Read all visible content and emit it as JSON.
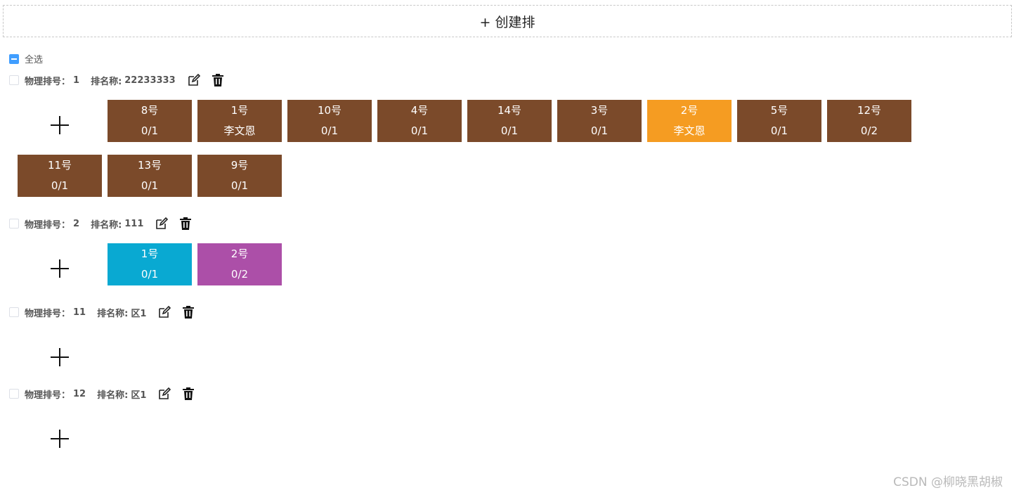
{
  "create_button": {
    "label": "+ 创建排"
  },
  "select_all": {
    "label": "全选"
  },
  "rows": [
    {
      "physical_label": "物理排号：",
      "physical_no": "1",
      "name_label": "排名称:",
      "name": "22233333",
      "seats": [
        {
          "num": "8号",
          "occ": "0/1",
          "color": "#7b4a2a"
        },
        {
          "num": "1号",
          "occ": "李文恩",
          "color": "#7b4a2a"
        },
        {
          "num": "10号",
          "occ": "0/1",
          "color": "#7b4a2a"
        },
        {
          "num": "4号",
          "occ": "0/1",
          "color": "#7b4a2a"
        },
        {
          "num": "14号",
          "occ": "0/1",
          "color": "#7b4a2a"
        },
        {
          "num": "3号",
          "occ": "0/1",
          "color": "#7b4a2a"
        },
        {
          "num": "2号",
          "occ": "李文恩",
          "color": "#f59c22"
        },
        {
          "num": "5号",
          "occ": "0/1",
          "color": "#7b4a2a"
        },
        {
          "num": "12号",
          "occ": "0/2",
          "color": "#7b4a2a"
        },
        {
          "num": "11号",
          "occ": "0/1",
          "color": "#7b4a2a"
        },
        {
          "num": "13号",
          "occ": "0/1",
          "color": "#7b4a2a"
        },
        {
          "num": "9号",
          "occ": "0/1",
          "color": "#7b4a2a"
        }
      ]
    },
    {
      "physical_label": "物理排号：",
      "physical_no": "2",
      "name_label": "排名称:",
      "name": "111",
      "seats": [
        {
          "num": "1号",
          "occ": "0/1",
          "color": "#09a9d2"
        },
        {
          "num": "2号",
          "occ": "0/2",
          "color": "#ac4fa8"
        }
      ]
    },
    {
      "physical_label": "物理排号：",
      "physical_no": "11",
      "name_label": "排名称:",
      "name": "区1",
      "seats": []
    },
    {
      "physical_label": "物理排号：",
      "physical_no": "12",
      "name_label": "排名称:",
      "name": "区1",
      "seats": []
    }
  ],
  "icons": {
    "edit": "edit-icon",
    "delete": "trash-icon",
    "add": "plus-icon"
  },
  "watermark": "CSDN @柳晓黑胡椒"
}
